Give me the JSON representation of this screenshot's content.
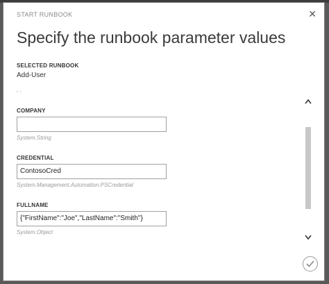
{
  "dialog": {
    "header": "START RUNBOOK",
    "title": "Specify the runbook parameter values",
    "close_icon": "close-icon",
    "selected_runbook": {
      "label": "SELECTED RUNBOOK",
      "value": "Add-User"
    },
    "fields": [
      {
        "label": "COMPANY",
        "value": "",
        "type": "System.String"
      },
      {
        "label": "CREDENTIAL",
        "value": "ContosoCred",
        "type": "System.Management.Automation.PSCredential"
      },
      {
        "label": "FULLNAME",
        "value": "{\"FirstName\":\"Joe\",\"LastName\":\"Smith\"}",
        "type": "System.Object"
      }
    ],
    "confirm_icon": "checkmark-icon",
    "colors": {
      "overlay": "#5a5a5a",
      "dialog_bg": "#ffffff",
      "scroll_thumb": "#c8c8c8"
    }
  }
}
